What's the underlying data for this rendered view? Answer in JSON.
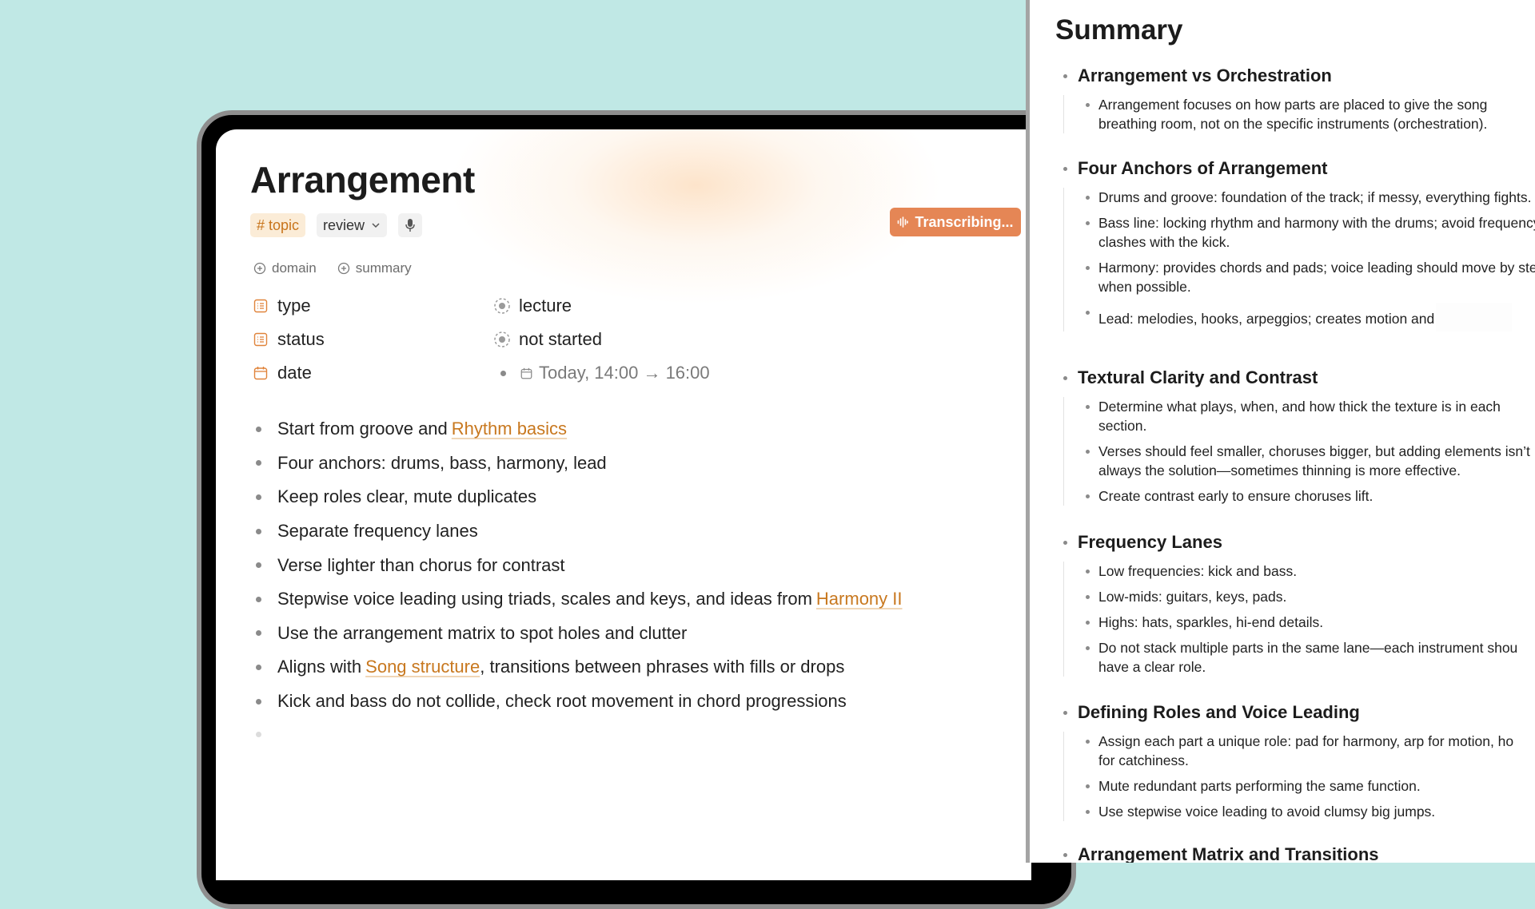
{
  "note": {
    "title": "Arrangement",
    "tags": {
      "topic": "topic",
      "review": "review"
    },
    "transcribe_button": "Transcribing...",
    "add_properties": [
      "domain",
      "summary"
    ],
    "properties": {
      "type": {
        "name": "type",
        "value": "lecture"
      },
      "status": {
        "name": "status",
        "value": "not started"
      },
      "date": {
        "name": "date",
        "value": "Today, 14:00 → 16:00"
      }
    },
    "bullets": {
      "b0": {
        "text": "Start from groove and ",
        "link": "Rhythm basics"
      },
      "b1": "Four anchors: drums, bass, harmony, lead",
      "b2": "Keep roles clear, mute duplicates",
      "b3": "Separate frequency lanes",
      "b4": "Verse lighter than chorus for contrast",
      "b5": {
        "text": "Stepwise voice leading using triads, scales and keys, and ideas from ",
        "link": "Harmony II"
      },
      "b6": "Use the arrangement matrix to spot holes and clutter",
      "b7": {
        "pre": "Aligns with ",
        "link": "Song structure",
        "post": ", transitions between phrases with fills or drops"
      },
      "b8": "Kick and bass do not collide, check root movement in chord progressions"
    },
    "colors": {
      "accent": "#c8781f",
      "transcribe": "#e58655",
      "background": "#c0e8e5"
    }
  },
  "summary": {
    "title": "Summary",
    "sections": [
      {
        "heading": "Arrangement vs Orchestration",
        "items": [
          "Arrangement focuses on how parts are placed to give the song breathing room, not on the specific instruments (orchestration)."
        ]
      },
      {
        "heading": "Four Anchors of Arrangement",
        "items": [
          "Drums and groove: foundation of the track; if messy, everything fights.",
          "Bass line: locking rhythm and harmony with the drums; avoid frequency clashes with the kick.",
          "Harmony: provides chords and pads; voice leading should move by step when possible.",
          "Lead: melodies, hooks, arpeggios; creates motion and"
        ]
      },
      {
        "heading": "Textural Clarity and Contrast",
        "items": [
          "Determine what plays, when, and how thick the texture is in each section.",
          "Verses should feel smaller, choruses bigger, but adding elements isn’t always the solution—sometimes thinning is more effective.",
          "Create contrast early to ensure choruses lift."
        ]
      },
      {
        "heading": "Frequency Lanes",
        "items": [
          "Low frequencies: kick and bass.",
          "Low-mids: guitars, keys, pads.",
          "Highs: hats, sparkles, hi-end details.",
          "Do not stack multiple parts in the same lane—each instrument shou",
          "have a clear role."
        ]
      },
      {
        "heading": "Defining Roles and Voice Leading",
        "items": [
          "Assign each part a unique role: pad for harmony, arp for motion, ho",
          "for catchiness.",
          "Mute redundant parts performing the same function.",
          "Use stepwise voice leading to avoid clumsy big jumps."
        ]
      },
      {
        "heading": "Arrangement Matrix and Transitions",
        "items": []
      }
    ]
  }
}
